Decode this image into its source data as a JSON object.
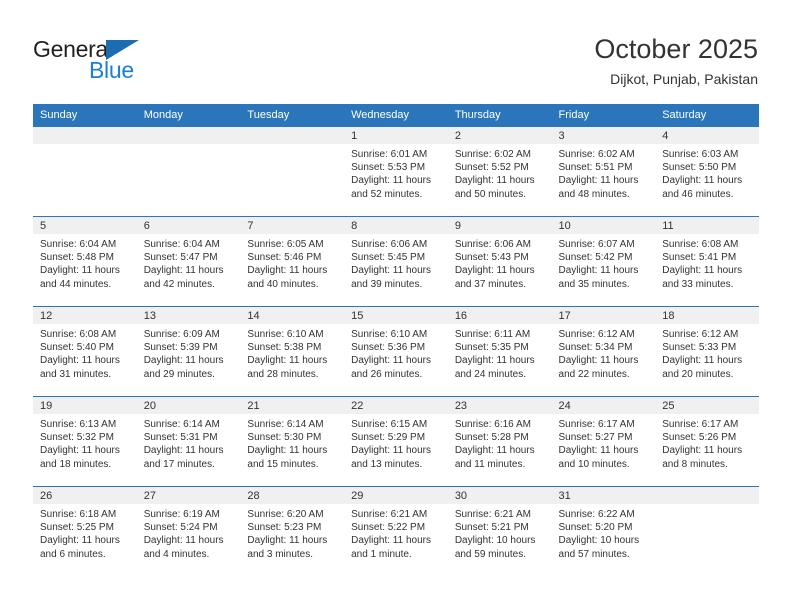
{
  "brand": {
    "logo_text_primary": "General",
    "logo_text_secondary": "Blue",
    "logo_triangle_color": "#1b6cb0",
    "logo_secondary_color": "#1b7fd4"
  },
  "header": {
    "title": "October 2025",
    "subtitle": "Dijkot, Punjab, Pakistan"
  },
  "theme": {
    "header_row_bg": "#2b76bb",
    "header_row_text": "#ffffff",
    "daynum_band_bg": "#f0f0f0",
    "cell_text": "#333333",
    "row_border": "#2b76bb"
  },
  "weekday_headers": [
    "Sunday",
    "Monday",
    "Tuesday",
    "Wednesday",
    "Thursday",
    "Friday",
    "Saturday"
  ],
  "weeks": [
    [
      {
        "day": "",
        "sunrise": "",
        "sunset": "",
        "daylight": "",
        "empty": true
      },
      {
        "day": "",
        "sunrise": "",
        "sunset": "",
        "daylight": "",
        "empty": true
      },
      {
        "day": "",
        "sunrise": "",
        "sunset": "",
        "daylight": "",
        "empty": true
      },
      {
        "day": "1",
        "sunrise": "Sunrise: 6:01 AM",
        "sunset": "Sunset: 5:53 PM",
        "daylight": "Daylight: 11 hours and 52 minutes."
      },
      {
        "day": "2",
        "sunrise": "Sunrise: 6:02 AM",
        "sunset": "Sunset: 5:52 PM",
        "daylight": "Daylight: 11 hours and 50 minutes."
      },
      {
        "day": "3",
        "sunrise": "Sunrise: 6:02 AM",
        "sunset": "Sunset: 5:51 PM",
        "daylight": "Daylight: 11 hours and 48 minutes."
      },
      {
        "day": "4",
        "sunrise": "Sunrise: 6:03 AM",
        "sunset": "Sunset: 5:50 PM",
        "daylight": "Daylight: 11 hours and 46 minutes."
      }
    ],
    [
      {
        "day": "5",
        "sunrise": "Sunrise: 6:04 AM",
        "sunset": "Sunset: 5:48 PM",
        "daylight": "Daylight: 11 hours and 44 minutes."
      },
      {
        "day": "6",
        "sunrise": "Sunrise: 6:04 AM",
        "sunset": "Sunset: 5:47 PM",
        "daylight": "Daylight: 11 hours and 42 minutes."
      },
      {
        "day": "7",
        "sunrise": "Sunrise: 6:05 AM",
        "sunset": "Sunset: 5:46 PM",
        "daylight": "Daylight: 11 hours and 40 minutes."
      },
      {
        "day": "8",
        "sunrise": "Sunrise: 6:06 AM",
        "sunset": "Sunset: 5:45 PM",
        "daylight": "Daylight: 11 hours and 39 minutes."
      },
      {
        "day": "9",
        "sunrise": "Sunrise: 6:06 AM",
        "sunset": "Sunset: 5:43 PM",
        "daylight": "Daylight: 11 hours and 37 minutes."
      },
      {
        "day": "10",
        "sunrise": "Sunrise: 6:07 AM",
        "sunset": "Sunset: 5:42 PM",
        "daylight": "Daylight: 11 hours and 35 minutes."
      },
      {
        "day": "11",
        "sunrise": "Sunrise: 6:08 AM",
        "sunset": "Sunset: 5:41 PM",
        "daylight": "Daylight: 11 hours and 33 minutes."
      }
    ],
    [
      {
        "day": "12",
        "sunrise": "Sunrise: 6:08 AM",
        "sunset": "Sunset: 5:40 PM",
        "daylight": "Daylight: 11 hours and 31 minutes."
      },
      {
        "day": "13",
        "sunrise": "Sunrise: 6:09 AM",
        "sunset": "Sunset: 5:39 PM",
        "daylight": "Daylight: 11 hours and 29 minutes."
      },
      {
        "day": "14",
        "sunrise": "Sunrise: 6:10 AM",
        "sunset": "Sunset: 5:38 PM",
        "daylight": "Daylight: 11 hours and 28 minutes."
      },
      {
        "day": "15",
        "sunrise": "Sunrise: 6:10 AM",
        "sunset": "Sunset: 5:36 PM",
        "daylight": "Daylight: 11 hours and 26 minutes."
      },
      {
        "day": "16",
        "sunrise": "Sunrise: 6:11 AM",
        "sunset": "Sunset: 5:35 PM",
        "daylight": "Daylight: 11 hours and 24 minutes."
      },
      {
        "day": "17",
        "sunrise": "Sunrise: 6:12 AM",
        "sunset": "Sunset: 5:34 PM",
        "daylight": "Daylight: 11 hours and 22 minutes."
      },
      {
        "day": "18",
        "sunrise": "Sunrise: 6:12 AM",
        "sunset": "Sunset: 5:33 PM",
        "daylight": "Daylight: 11 hours and 20 minutes."
      }
    ],
    [
      {
        "day": "19",
        "sunrise": "Sunrise: 6:13 AM",
        "sunset": "Sunset: 5:32 PM",
        "daylight": "Daylight: 11 hours and 18 minutes."
      },
      {
        "day": "20",
        "sunrise": "Sunrise: 6:14 AM",
        "sunset": "Sunset: 5:31 PM",
        "daylight": "Daylight: 11 hours and 17 minutes."
      },
      {
        "day": "21",
        "sunrise": "Sunrise: 6:14 AM",
        "sunset": "Sunset: 5:30 PM",
        "daylight": "Daylight: 11 hours and 15 minutes."
      },
      {
        "day": "22",
        "sunrise": "Sunrise: 6:15 AM",
        "sunset": "Sunset: 5:29 PM",
        "daylight": "Daylight: 11 hours and 13 minutes."
      },
      {
        "day": "23",
        "sunrise": "Sunrise: 6:16 AM",
        "sunset": "Sunset: 5:28 PM",
        "daylight": "Daylight: 11 hours and 11 minutes."
      },
      {
        "day": "24",
        "sunrise": "Sunrise: 6:17 AM",
        "sunset": "Sunset: 5:27 PM",
        "daylight": "Daylight: 11 hours and 10 minutes."
      },
      {
        "day": "25",
        "sunrise": "Sunrise: 6:17 AM",
        "sunset": "Sunset: 5:26 PM",
        "daylight": "Daylight: 11 hours and 8 minutes."
      }
    ],
    [
      {
        "day": "26",
        "sunrise": "Sunrise: 6:18 AM",
        "sunset": "Sunset: 5:25 PM",
        "daylight": "Daylight: 11 hours and 6 minutes."
      },
      {
        "day": "27",
        "sunrise": "Sunrise: 6:19 AM",
        "sunset": "Sunset: 5:24 PM",
        "daylight": "Daylight: 11 hours and 4 minutes."
      },
      {
        "day": "28",
        "sunrise": "Sunrise: 6:20 AM",
        "sunset": "Sunset: 5:23 PM",
        "daylight": "Daylight: 11 hours and 3 minutes."
      },
      {
        "day": "29",
        "sunrise": "Sunrise: 6:21 AM",
        "sunset": "Sunset: 5:22 PM",
        "daylight": "Daylight: 11 hours and 1 minute."
      },
      {
        "day": "30",
        "sunrise": "Sunrise: 6:21 AM",
        "sunset": "Sunset: 5:21 PM",
        "daylight": "Daylight: 10 hours and 59 minutes."
      },
      {
        "day": "31",
        "sunrise": "Sunrise: 6:22 AM",
        "sunset": "Sunset: 5:20 PM",
        "daylight": "Daylight: 10 hours and 57 minutes."
      },
      {
        "day": "",
        "sunrise": "",
        "sunset": "",
        "daylight": "",
        "empty": true
      }
    ]
  ]
}
